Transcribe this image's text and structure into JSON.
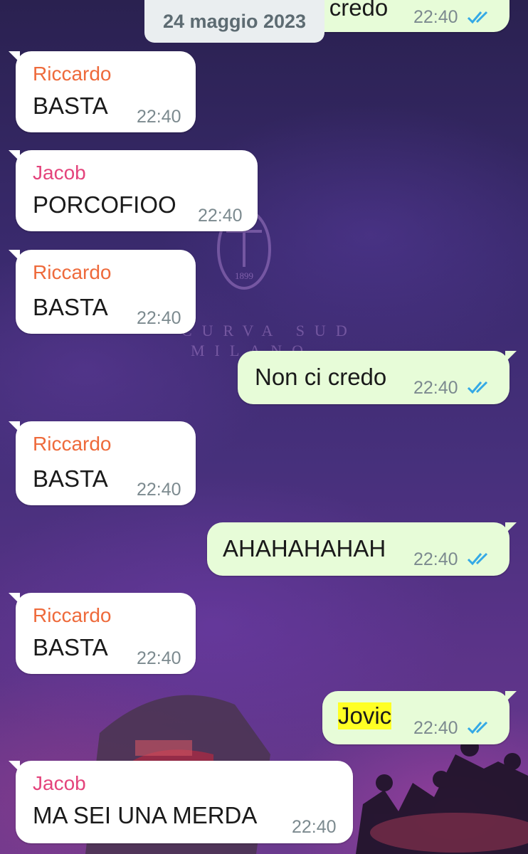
{
  "date_separator": "24 maggio 2023",
  "wallpaper": {
    "crest_year": "1899",
    "text_line1": "CURVA SUD",
    "text_line2": "MILANO"
  },
  "messages": [
    {
      "direction": "out",
      "text": "Non ci credo",
      "time": "22:40",
      "status": "read"
    },
    {
      "direction": "in",
      "sender": "Riccardo",
      "text": "BASTA",
      "time": "22:40"
    },
    {
      "direction": "in",
      "sender": "Jacob",
      "text": "PORCOFIOO",
      "time": "22:40"
    },
    {
      "direction": "in",
      "sender": "Riccardo",
      "text": "BASTA",
      "time": "22:40"
    },
    {
      "direction": "out",
      "text": "Non ci credo",
      "time": "22:40",
      "status": "read"
    },
    {
      "direction": "in",
      "sender": "Riccardo",
      "text": "BASTA",
      "time": "22:40"
    },
    {
      "direction": "out",
      "text": "AHAHAHAHAH",
      "time": "22:40",
      "status": "read"
    },
    {
      "direction": "in",
      "sender": "Riccardo",
      "text": "BASTA",
      "time": "22:40"
    },
    {
      "direction": "out",
      "text": "Jovic",
      "time": "22:40",
      "status": "read",
      "highlighted": true
    },
    {
      "direction": "in",
      "sender": "Jacob",
      "text": "MA SEI UNA MERDA",
      "time": "22:40"
    }
  ],
  "colors": {
    "incoming_bubble": "#ffffff",
    "outgoing_bubble": "#e7fcd8",
    "sender_riccardo": "#ee6a3b",
    "sender_jacob": "#e4447c",
    "read_ticks": "#34a9e6",
    "search_highlight": "#ffff24"
  },
  "icons": {
    "read_receipt": "double-check-icon"
  }
}
